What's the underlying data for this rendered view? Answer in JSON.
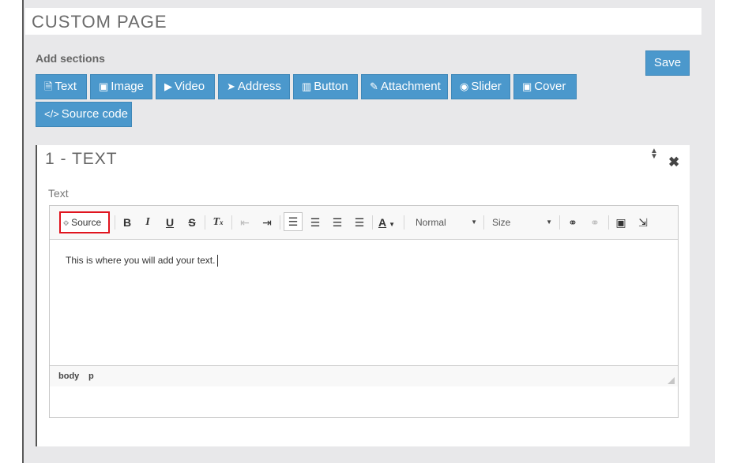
{
  "page": {
    "title": "CUSTOM PAGE"
  },
  "add_sections": {
    "label": "Add sections",
    "save_label": "Save",
    "buttons": [
      {
        "label": "Text",
        "icon": "file-text-icon",
        "glyph": "🗎"
      },
      {
        "label": "Image",
        "icon": "image-icon",
        "glyph": "🖼"
      },
      {
        "label": "Video",
        "icon": "video-file-icon",
        "glyph": "▶"
      },
      {
        "label": "Address",
        "icon": "location-arrow-icon",
        "glyph": "➤"
      },
      {
        "label": "Button",
        "icon": "barcode-icon",
        "glyph": "▥"
      },
      {
        "label": "Attachment",
        "icon": "paperclip-icon",
        "glyph": "✎"
      },
      {
        "label": "Slider",
        "icon": "play-circle-icon",
        "glyph": "▶"
      },
      {
        "label": "Cover",
        "icon": "picture-icon",
        "glyph": "▣"
      },
      {
        "label": "Source code",
        "icon": "code-icon",
        "glyph": "</>"
      }
    ]
  },
  "section": {
    "title": "1 - TEXT",
    "field_label": "Text",
    "editor": {
      "toolbar": {
        "source_label": "Source",
        "format_value": "Normal",
        "size_value": "Size"
      },
      "content": "This is where you will add your text.",
      "status_path": [
        "body",
        "p"
      ]
    }
  },
  "colors": {
    "accent": "#4b98cc",
    "highlight": "#e0141e"
  }
}
